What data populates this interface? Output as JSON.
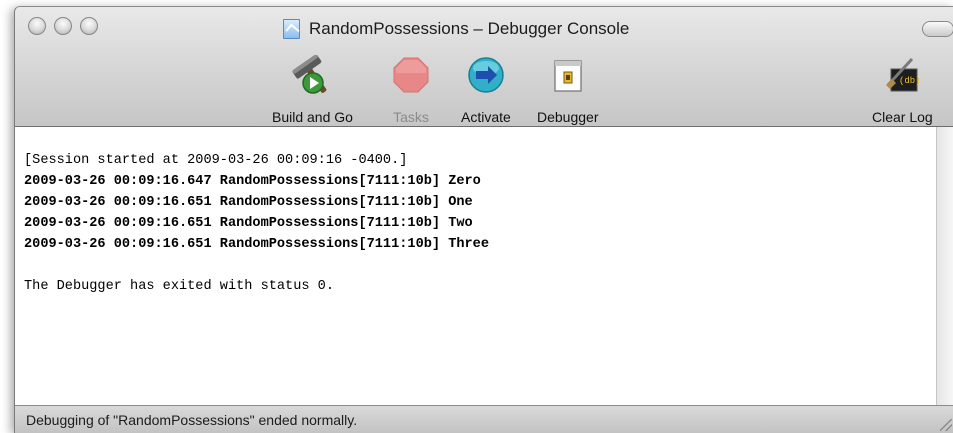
{
  "window": {
    "title": "RandomPossessions – Debugger Console",
    "title_icon": "document-icon"
  },
  "toolbar": {
    "buttons": [
      {
        "id": "build-and-go",
        "label": "Build and Go",
        "icon": "hammer-play-icon",
        "enabled": true
      },
      {
        "id": "tasks",
        "label": "Tasks",
        "icon": "stop-octagon-icon",
        "enabled": false
      },
      {
        "id": "activate",
        "label": "Activate",
        "icon": "arrow-circle-icon",
        "enabled": true
      },
      {
        "id": "debugger",
        "label": "Debugger",
        "icon": "debugger-window-icon",
        "enabled": true
      },
      {
        "id": "clear-log",
        "label": "Clear Log",
        "icon": "broom-icon",
        "enabled": true
      }
    ]
  },
  "console": {
    "lines": [
      {
        "text": "[Session started at 2009-03-26 00:09:16 -0400.]",
        "bold": false
      },
      {
        "text": "2009-03-26 00:09:16.647 RandomPossessions[7111:10b] Zero",
        "bold": true
      },
      {
        "text": "2009-03-26 00:09:16.651 RandomPossessions[7111:10b] One",
        "bold": true
      },
      {
        "text": "2009-03-26 00:09:16.651 RandomPossessions[7111:10b] Two",
        "bold": true
      },
      {
        "text": "2009-03-26 00:09:16.651 RandomPossessions[7111:10b] Three",
        "bold": true
      },
      {
        "text": "",
        "bold": false
      },
      {
        "text": "The Debugger has exited with status 0.",
        "bold": false
      }
    ]
  },
  "statusbar": {
    "text": "Debugging of \"RandomPossessions\" ended normally."
  },
  "colors": {
    "tasks_stop_red": "#e06a6a",
    "activate_teal": "#2fb0c8"
  }
}
